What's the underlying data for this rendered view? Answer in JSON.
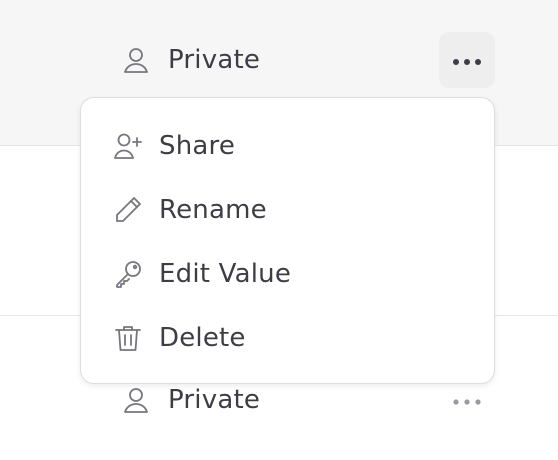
{
  "rows": [
    {
      "owner_label": "Private",
      "owner_icon": "user-icon",
      "more_icon": "more-horizontal-icon"
    },
    {
      "owner_label": "Private",
      "owner_icon": "user-icon",
      "more_icon": "more-horizontal-icon"
    }
  ],
  "menu": {
    "items": [
      {
        "label": "Share",
        "icon": "user-plus-icon"
      },
      {
        "label": "Rename",
        "icon": "pencil-icon"
      },
      {
        "label": "Edit Value",
        "icon": "key-icon"
      },
      {
        "label": "Delete",
        "icon": "trash-icon"
      }
    ]
  },
  "colors": {
    "text": "#3d3d45",
    "icon": "#76767e",
    "row_highlight": "#f6f6f6",
    "button_active": "#eeeeee",
    "border": "#dedede"
  }
}
